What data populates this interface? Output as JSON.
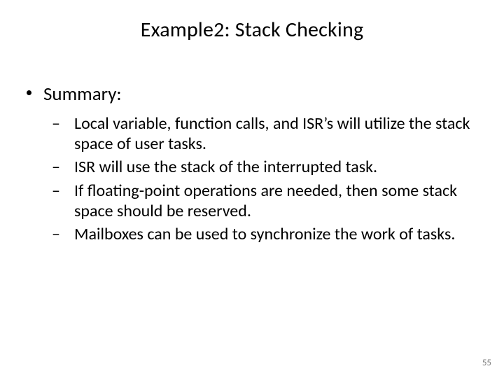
{
  "slide": {
    "title": "Example2: Stack Checking",
    "summary_label": "Summary:",
    "points": [
      "Local variable, function calls, and ISR’s will utilize the stack space of user tasks.",
      "ISR will use the stack of the interrupted task.",
      "If floating-point operations are needed, then some stack space should be reserved.",
      "Mailboxes can be used to synchronize the work of tasks."
    ],
    "page_number": "55"
  }
}
